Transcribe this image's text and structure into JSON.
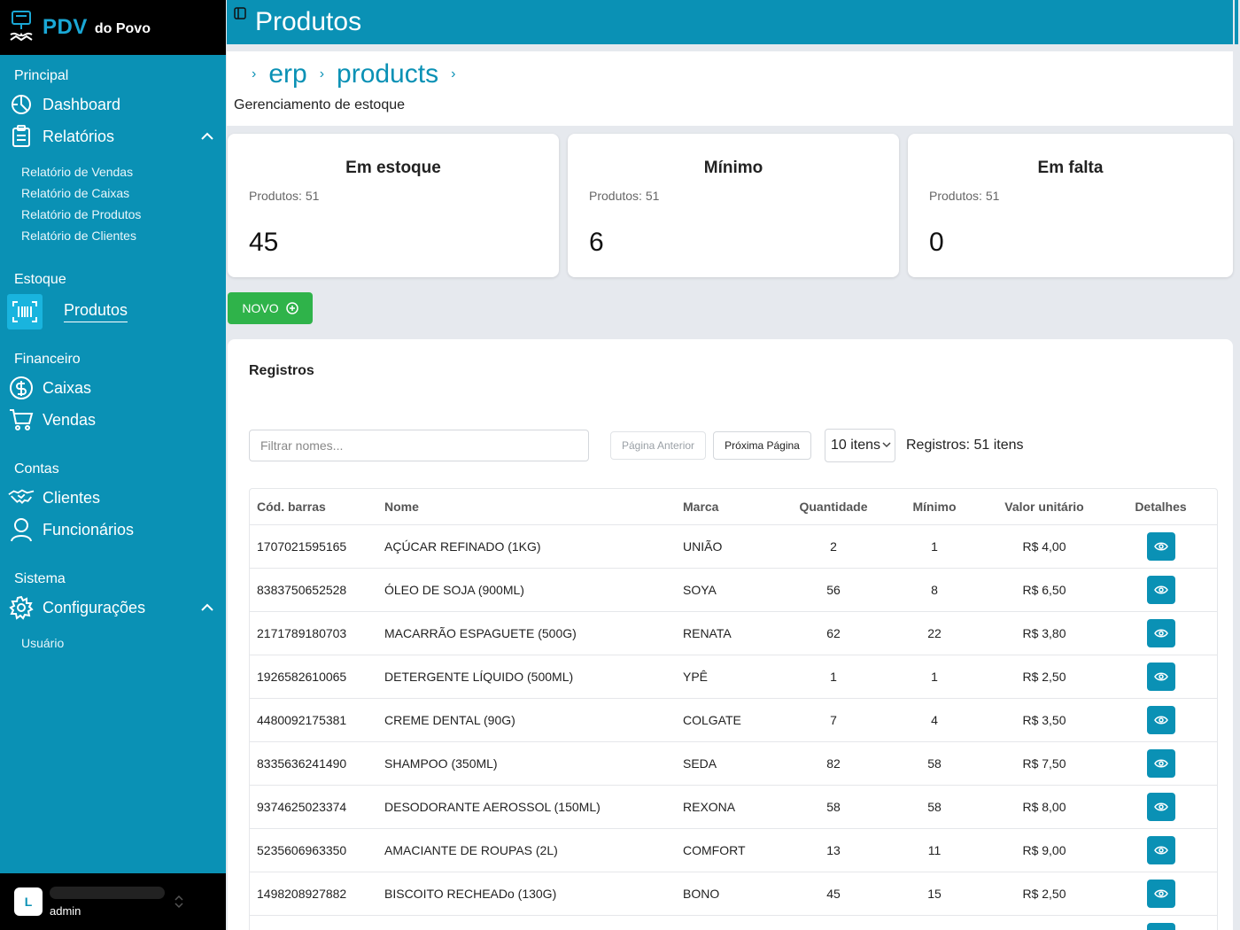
{
  "brand": {
    "name": "PDV",
    "subtitle": "do Povo"
  },
  "sidebar": {
    "sections": [
      {
        "title": "Principal"
      },
      {
        "title": "Estoque"
      },
      {
        "title": "Financeiro"
      },
      {
        "title": "Contas"
      },
      {
        "title": "Sistema"
      }
    ],
    "dashboard": "Dashboard",
    "relatorios": "Relatórios",
    "relatorios_sub": [
      "Relatório de Vendas",
      "Relatório de Caixas",
      "Relatório de Produtos",
      "Relatório de Clientes"
    ],
    "produtos": "Produtos",
    "caixas": "Caixas",
    "vendas": "Vendas",
    "clientes": "Clientes",
    "funcionarios": "Funcionários",
    "configuracoes": "Configurações",
    "config_sub": [
      "Usuário"
    ]
  },
  "user": {
    "initial": "L",
    "role": "admin"
  },
  "header": {
    "title": "Produtos"
  },
  "breadcrumb": {
    "items": [
      "erp",
      "products"
    ],
    "description": "Gerenciamento de estoque"
  },
  "cards": [
    {
      "title": "Em estoque",
      "subtitle": "Produtos: 51",
      "value": "45"
    },
    {
      "title": "Mínimo",
      "subtitle": "Produtos: 51",
      "value": "6"
    },
    {
      "title": "Em falta",
      "subtitle": "Produtos: 51",
      "value": "0"
    }
  ],
  "actions": {
    "new_label": "NOVO"
  },
  "records": {
    "title": "Registros",
    "filter_placeholder": "Filtrar nomes...",
    "prev_label": "Página Anterior",
    "next_label": "Próxima Página",
    "page_size": "10 itens",
    "count": "Registros: 51 itens",
    "columns": [
      "Cód. barras",
      "Nome",
      "Marca",
      "Quantidade",
      "Mínimo",
      "Valor unitário",
      "Detalhes"
    ],
    "rows": [
      [
        "1707021595165",
        "AÇÚCAR REFINADO (1KG)",
        "UNIÃO",
        "2",
        "1",
        "R$ 4,00"
      ],
      [
        "8383750652528",
        "ÓLEO DE SOJA (900ML)",
        "SOYA",
        "56",
        "8",
        "R$ 6,50"
      ],
      [
        "2171789180703",
        "MACARRÃO ESPAGUETE (500G)",
        "RENATA",
        "62",
        "22",
        "R$ 3,80"
      ],
      [
        "1926582610065",
        "DETERGENTE LÍQUIDO (500ML)",
        "YPÊ",
        "1",
        "1",
        "R$ 2,50"
      ],
      [
        "4480092175381",
        "CREME DENTAL (90G)",
        "COLGATE",
        "7",
        "4",
        "R$ 3,50"
      ],
      [
        "8335636241490",
        "SHAMPOO (350ML)",
        "SEDA",
        "82",
        "58",
        "R$ 7,50"
      ],
      [
        "9374625023374",
        "DESODORANTE AEROSSOL (150ML)",
        "REXONA",
        "58",
        "58",
        "R$ 8,00"
      ],
      [
        "5235606963350",
        "AMACIANTE DE ROUPAS (2L)",
        "COMFORT",
        "13",
        "11",
        "R$ 9,00"
      ],
      [
        "1498208927882",
        "BISCOITO RECHEADo (130G)",
        "BONO",
        "45",
        "15",
        "R$ 2,50"
      ]
    ]
  },
  "colors": {
    "primary": "#0a91b5",
    "success": "#2fb34a",
    "sidebar_header": "#000000"
  }
}
